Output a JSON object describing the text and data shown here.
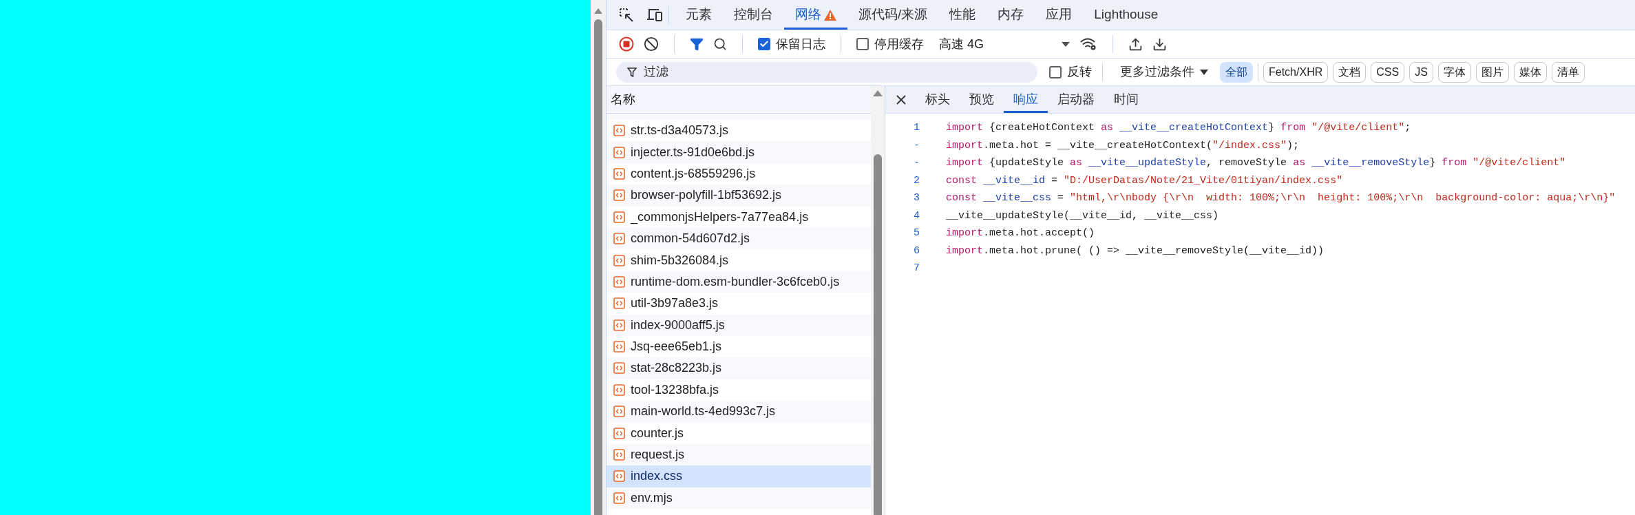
{
  "devtools": {
    "tabs": [
      {
        "label": "元素",
        "selected": false,
        "warning": false
      },
      {
        "label": "控制台",
        "selected": false,
        "warning": false
      },
      {
        "label": "网络",
        "selected": true,
        "warning": true
      },
      {
        "label": "源代码/来源",
        "selected": false,
        "warning": false
      },
      {
        "label": "性能",
        "selected": false,
        "warning": false
      },
      {
        "label": "内存",
        "selected": false,
        "warning": false
      },
      {
        "label": "应用",
        "selected": false,
        "warning": false
      },
      {
        "label": "Lighthouse",
        "selected": false,
        "warning": false
      }
    ],
    "toolbar": {
      "preserve_log": {
        "label": "保留日志",
        "checked": true
      },
      "disable_cache": {
        "label": "停用缓存",
        "checked": false
      },
      "throttling": "高速 4G"
    },
    "filter_bar": {
      "placeholder": "过滤",
      "invert": {
        "label": "反转",
        "checked": false
      },
      "more_filters": "更多过滤条件",
      "types": [
        {
          "label": "全部",
          "selected": true
        },
        {
          "label": "Fetch/XHR",
          "selected": false
        },
        {
          "label": "文档",
          "selected": false
        },
        {
          "label": "CSS",
          "selected": false
        },
        {
          "label": "JS",
          "selected": false
        },
        {
          "label": "字体",
          "selected": false
        },
        {
          "label": "图片",
          "selected": false
        },
        {
          "label": "媒体",
          "selected": false
        },
        {
          "label": "清单",
          "selected": false
        }
      ]
    },
    "request_list": {
      "column": "名称",
      "rows": [
        {
          "name": "str.ts-d3a40573.js",
          "selected": false
        },
        {
          "name": "injecter.ts-91d0e6bd.js",
          "selected": false
        },
        {
          "name": "content.js-68559296.js",
          "selected": false
        },
        {
          "name": "browser-polyfill-1bf53692.js",
          "selected": false
        },
        {
          "name": "_commonjsHelpers-7a77ea84.js",
          "selected": false
        },
        {
          "name": "common-54d607d2.js",
          "selected": false
        },
        {
          "name": "shim-5b326084.js",
          "selected": false
        },
        {
          "name": "runtime-dom.esm-bundler-3c6fceb0.js",
          "selected": false
        },
        {
          "name": "util-3b97a8e3.js",
          "selected": false
        },
        {
          "name": "index-9000aff5.js",
          "selected": false
        },
        {
          "name": "Jsq-eee65eb1.js",
          "selected": false
        },
        {
          "name": "stat-28c8223b.js",
          "selected": false
        },
        {
          "name": "tool-13238bfa.js",
          "selected": false
        },
        {
          "name": "main-world.ts-4ed993c7.js",
          "selected": false
        },
        {
          "name": "counter.js",
          "selected": false
        },
        {
          "name": "request.js",
          "selected": false
        },
        {
          "name": "index.css",
          "selected": true
        },
        {
          "name": "env.mjs",
          "selected": false
        }
      ]
    },
    "detail": {
      "tabs": [
        {
          "label": "标头",
          "selected": false
        },
        {
          "label": "预览",
          "selected": false
        },
        {
          "label": "响应",
          "selected": true
        },
        {
          "label": "启动器",
          "selected": false
        },
        {
          "label": "时间",
          "selected": false
        }
      ],
      "code_lines": [
        {
          "number": "1",
          "tokens": [
            {
              "text": "import",
              "kind": "keyword"
            },
            {
              "text": " {createHotContext ",
              "kind": "plain"
            },
            {
              "text": "as",
              "kind": "keyword"
            },
            {
              "text": " __vite__createHotContext",
              "kind": "def"
            },
            {
              "text": "} ",
              "kind": "plain"
            },
            {
              "text": "from",
              "kind": "keyword"
            },
            {
              "text": " \"/@vite/client\"",
              "kind": "string"
            },
            {
              "text": ";",
              "kind": "plain"
            }
          ]
        },
        {
          "number": "-",
          "tokens": [
            {
              "text": "import",
              "kind": "keyword"
            },
            {
              "text": ".meta.hot = __vite__createHotContext(",
              "kind": "plain"
            },
            {
              "text": "\"/index.css\"",
              "kind": "string"
            },
            {
              "text": ");",
              "kind": "plain"
            }
          ]
        },
        {
          "number": "-",
          "tokens": [
            {
              "text": "import",
              "kind": "keyword"
            },
            {
              "text": " {updateStyle ",
              "kind": "plain"
            },
            {
              "text": "as",
              "kind": "keyword"
            },
            {
              "text": " __vite__updateStyle",
              "kind": "def"
            },
            {
              "text": ", removeStyle ",
              "kind": "plain"
            },
            {
              "text": "as",
              "kind": "keyword"
            },
            {
              "text": " __vite__removeStyle",
              "kind": "def"
            },
            {
              "text": "} ",
              "kind": "plain"
            },
            {
              "text": "from",
              "kind": "keyword"
            },
            {
              "text": " \"/@vite/client\"",
              "kind": "string"
            }
          ]
        },
        {
          "number": "2",
          "tokens": [
            {
              "text": "const",
              "kind": "keyword"
            },
            {
              "text": " __vite__id",
              "kind": "def"
            },
            {
              "text": " = ",
              "kind": "plain"
            },
            {
              "text": "\"D:/UserDatas/Note/21_Vite/01tiyan/index.css\"",
              "kind": "string"
            }
          ]
        },
        {
          "number": "3",
          "tokens": [
            {
              "text": "const",
              "kind": "keyword"
            },
            {
              "text": " __vite__css",
              "kind": "def"
            },
            {
              "text": " = ",
              "kind": "plain"
            },
            {
              "text": "\"html,\\r\\nbody {\\r\\n  width: 100%;\\r\\n  height: 100%;\\r\\n  background-color: aqua;\\r\\n}\"",
              "kind": "string"
            }
          ]
        },
        {
          "number": "4",
          "tokens": [
            {
              "text": "__vite__updateStyle(__vite__id, __vite__css)",
              "kind": "plain"
            }
          ]
        },
        {
          "number": "5",
          "tokens": [
            {
              "text": "import",
              "kind": "keyword"
            },
            {
              "text": ".meta.hot.accept()",
              "kind": "plain"
            }
          ]
        },
        {
          "number": "6",
          "tokens": [
            {
              "text": "import",
              "kind": "keyword"
            },
            {
              "text": ".meta.hot.prune( () => __vite__removeStyle(__vite__id))",
              "kind": "plain"
            }
          ]
        },
        {
          "number": "7"
        }
      ]
    }
  }
}
